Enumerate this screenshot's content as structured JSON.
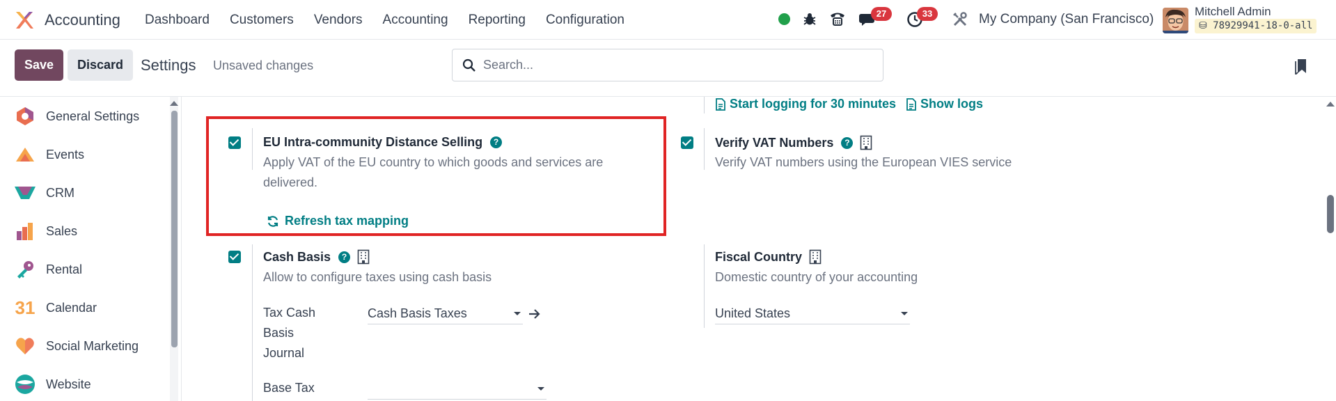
{
  "navbar": {
    "app_name": "Accounting",
    "menu": [
      "Dashboard",
      "Customers",
      "Vendors",
      "Accounting",
      "Reporting",
      "Configuration"
    ],
    "messages_count": "27",
    "activities_count": "33",
    "company": "My Company (San Francisco)",
    "user_name": "Mitchell Admin",
    "db_name": "78929941-18-0-all"
  },
  "control": {
    "save_label": "Save",
    "discard_label": "Discard",
    "title": "Settings",
    "unsaved": "Unsaved changes",
    "search_placeholder": "Search..."
  },
  "sidebar": {
    "items": [
      {
        "label": "General Settings",
        "icon": "general-settings-icon"
      },
      {
        "label": "Events",
        "icon": "events-icon"
      },
      {
        "label": "CRM",
        "icon": "crm-icon"
      },
      {
        "label": "Sales",
        "icon": "sales-icon"
      },
      {
        "label": "Rental",
        "icon": "rental-icon"
      },
      {
        "label": "Calendar",
        "icon": "calendar-icon",
        "icon_text": "31"
      },
      {
        "label": "Social Marketing",
        "icon": "social-marketing-icon"
      },
      {
        "label": "Website",
        "icon": "website-icon"
      }
    ]
  },
  "main": {
    "logs": {
      "start_logging": "Start logging for 30 minutes",
      "show_logs": "Show logs"
    },
    "eu_distance": {
      "title": "EU Intra-community Distance Selling",
      "desc_line1": "Apply VAT of the EU country to which goods and services are",
      "desc_line2": "delivered.",
      "link": "Refresh tax mapping",
      "checked": true
    },
    "verify_vat": {
      "title": "Verify VAT Numbers",
      "desc": "Verify VAT numbers using the European VIES service",
      "checked": true
    },
    "cash_basis": {
      "title": "Cash Basis",
      "desc": "Allow to configure taxes using cash basis",
      "checked": true,
      "journal_label_1": "Tax Cash",
      "journal_label_2": "Basis",
      "journal_label_3": "Journal",
      "journal_value": "Cash Basis Taxes",
      "base_tax_label": "Base Tax"
    },
    "fiscal_country": {
      "title": "Fiscal Country",
      "desc": "Domestic country of your accounting",
      "value": "United States"
    }
  },
  "colors": {
    "accent": "#017e84",
    "brand": "#71475f",
    "highlight": "#e02424"
  }
}
